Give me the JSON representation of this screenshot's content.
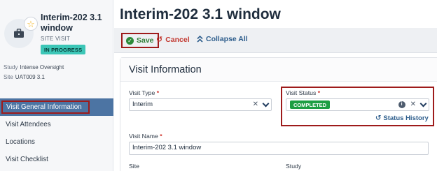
{
  "record": {
    "title": "Interim-202 3.1 window",
    "subtitle": "SITE VISIT",
    "status_badge": "IN PROGRESS",
    "study_label": "Study",
    "study_value": "Intense Oversight",
    "site_label": "Site",
    "site_value": "UAT009 3.1"
  },
  "sidebar": {
    "items": [
      {
        "label": "Visit General Information",
        "active": true
      },
      {
        "label": "Visit Attendees"
      },
      {
        "label": "Locations"
      },
      {
        "label": "Visit Checklist"
      }
    ]
  },
  "page": {
    "title": "Interim-202 3.1 window"
  },
  "toolbar": {
    "save_label": "Save",
    "cancel_label": "Cancel",
    "collapse_label": "Collapse All"
  },
  "section": {
    "title": "Visit Information",
    "visit_type_label": "Visit Type",
    "visit_type_value": "Interim",
    "visit_status_label": "Visit Status",
    "visit_status_value": "COMPLETED",
    "status_history_label": "Status History",
    "visit_name_label": "Visit Name",
    "visit_name_value": "Interim-202 3.1 window",
    "site_label": "Site",
    "study_label": "Study",
    "required_marker": "*"
  },
  "colors": {
    "active_nav": "#4c74a3",
    "badge": "#3cc6b7",
    "completed": "#1e9e43",
    "highlight_border": "#9e1b1b"
  }
}
